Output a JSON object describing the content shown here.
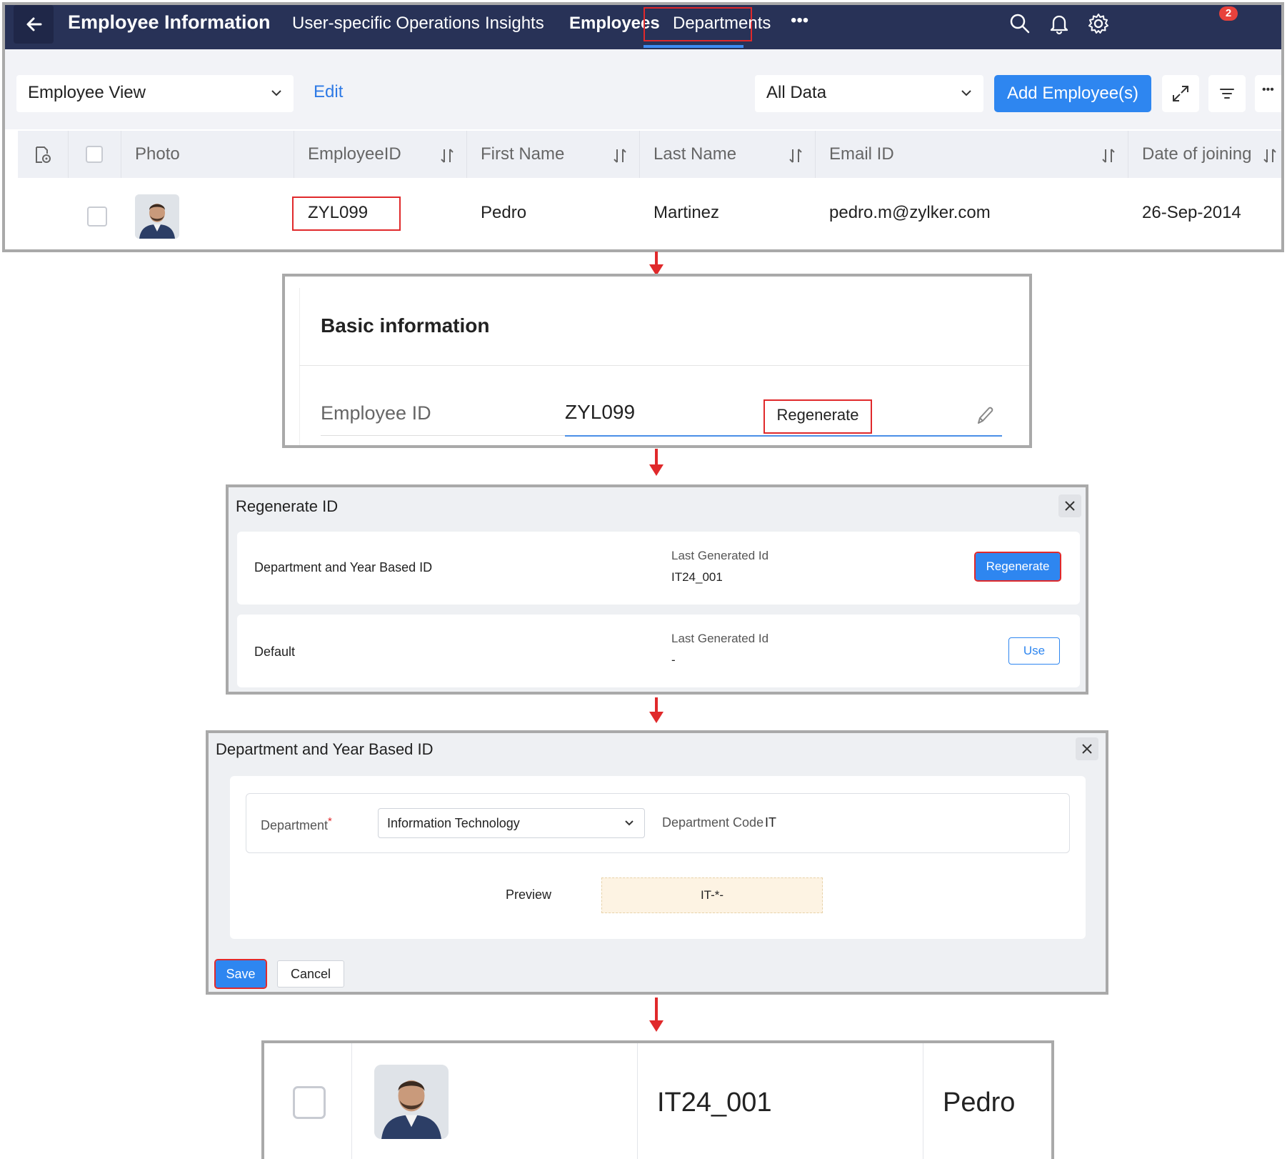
{
  "panel1": {
    "app_title": "Employee Information",
    "nav": [
      "User-specific Operations",
      "Insights",
      "Employees",
      "Departments",
      "•••"
    ],
    "notification_count": "2",
    "view_select": "Employee View",
    "edit_link": "Edit",
    "data_select": "All Data",
    "add_button": "Add Employee(s)",
    "more_label": "•••",
    "columns": [
      "Photo",
      "EmployeeID",
      "First Name",
      "Last Name",
      "Email ID",
      "Date of joining"
    ],
    "row": {
      "employee_id": "ZYL099",
      "first_name": "Pedro",
      "last_name": "Martinez",
      "email": "pedro.m@zylker.com",
      "date_of_joining": "26-Sep-2014"
    }
  },
  "panel2": {
    "section_title": "Basic information",
    "field_label": "Employee ID",
    "field_value": "ZYL099",
    "regenerate_label": "Regenerate"
  },
  "panel3": {
    "title": "Regenerate ID",
    "options": [
      {
        "name": "Department and Year Based ID",
        "last_label": "Last Generated Id",
        "last_value": "IT24_001",
        "action": "Regenerate"
      },
      {
        "name": "Default",
        "last_label": "Last Generated Id",
        "last_value": "-",
        "action": "Use"
      }
    ]
  },
  "panel4": {
    "title": "Department and Year Based ID",
    "department_label": "Department",
    "required_mark": "*",
    "department_value": "Information Technology",
    "dept_code_label": "Department Code",
    "dept_code_value": "IT",
    "preview_label": "Preview",
    "preview_value": "IT-*-",
    "save_label": "Save",
    "cancel_label": "Cancel"
  },
  "panel5": {
    "employee_id": "IT24_001",
    "first_name": "Pedro"
  },
  "colors": {
    "topbar": "#283257",
    "primary": "#2e86f0",
    "highlight": "#e0292b",
    "panel_border": "#a9a9a9"
  }
}
